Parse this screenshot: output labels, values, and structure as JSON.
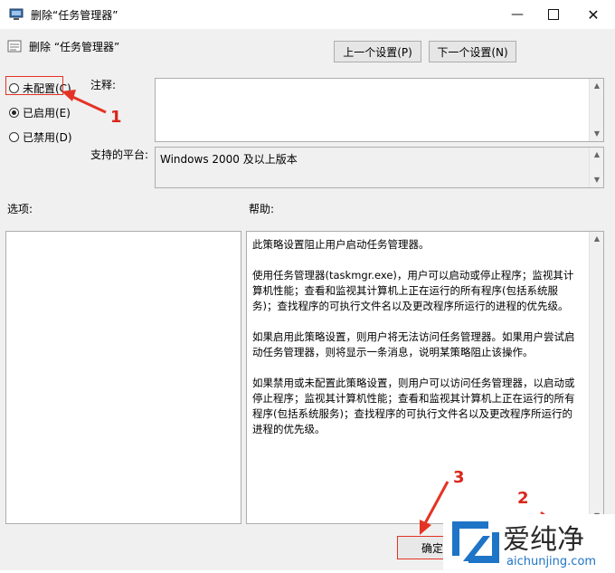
{
  "window": {
    "title": "删除“任务管理器”",
    "minimize_icon": "minimize-icon",
    "maximize_icon": "maximize-icon",
    "close_icon": "close-icon"
  },
  "header": {
    "policy_title": "删除 “任务管理器”",
    "prev_button": "上一个设置(P)",
    "next_button": "下一个设置(N)"
  },
  "state": {
    "options": [
      {
        "label": "未配置(C)",
        "checked": false
      },
      {
        "label": "已启用(E)",
        "checked": true
      },
      {
        "label": "已禁用(D)",
        "checked": false
      }
    ]
  },
  "comment": {
    "label": "注释:",
    "value": ""
  },
  "platform": {
    "label": "支持的平台:",
    "value": "Windows 2000 及以上版本"
  },
  "options_pane": {
    "label": "选项:"
  },
  "help_pane": {
    "label": "帮助:",
    "text": "此策略设置阻止用户启动任务管理器。\n\n使用任务管理器(taskmgr.exe)，用户可以启动或停止程序；监视其计算机性能；查看和监视其计算机上正在运行的所有程序(包括系统服务)；查找程序的可执行文件名以及更改程序所运行的进程的优先级。\n\n如果启用此策略设置，则用户将无法访问任务管理器。如果用户尝试启动任务管理器，则将显示一条消息，说明某策略阻止该操作。\n\n如果禁用或未配置此策略设置，则用户可以访问任务管理器，以启动或停止程序；监视其计算机性能；查看和监视其计算机上正在运行的所有程序(包括系统服务)；查找程序的可执行文件名以及更改程序所运行的进程的优先级。"
  },
  "footer": {
    "ok_button": "确定"
  },
  "annotations": {
    "n1": "1",
    "n2": "2",
    "n3": "3",
    "color": "#e43325"
  }
}
